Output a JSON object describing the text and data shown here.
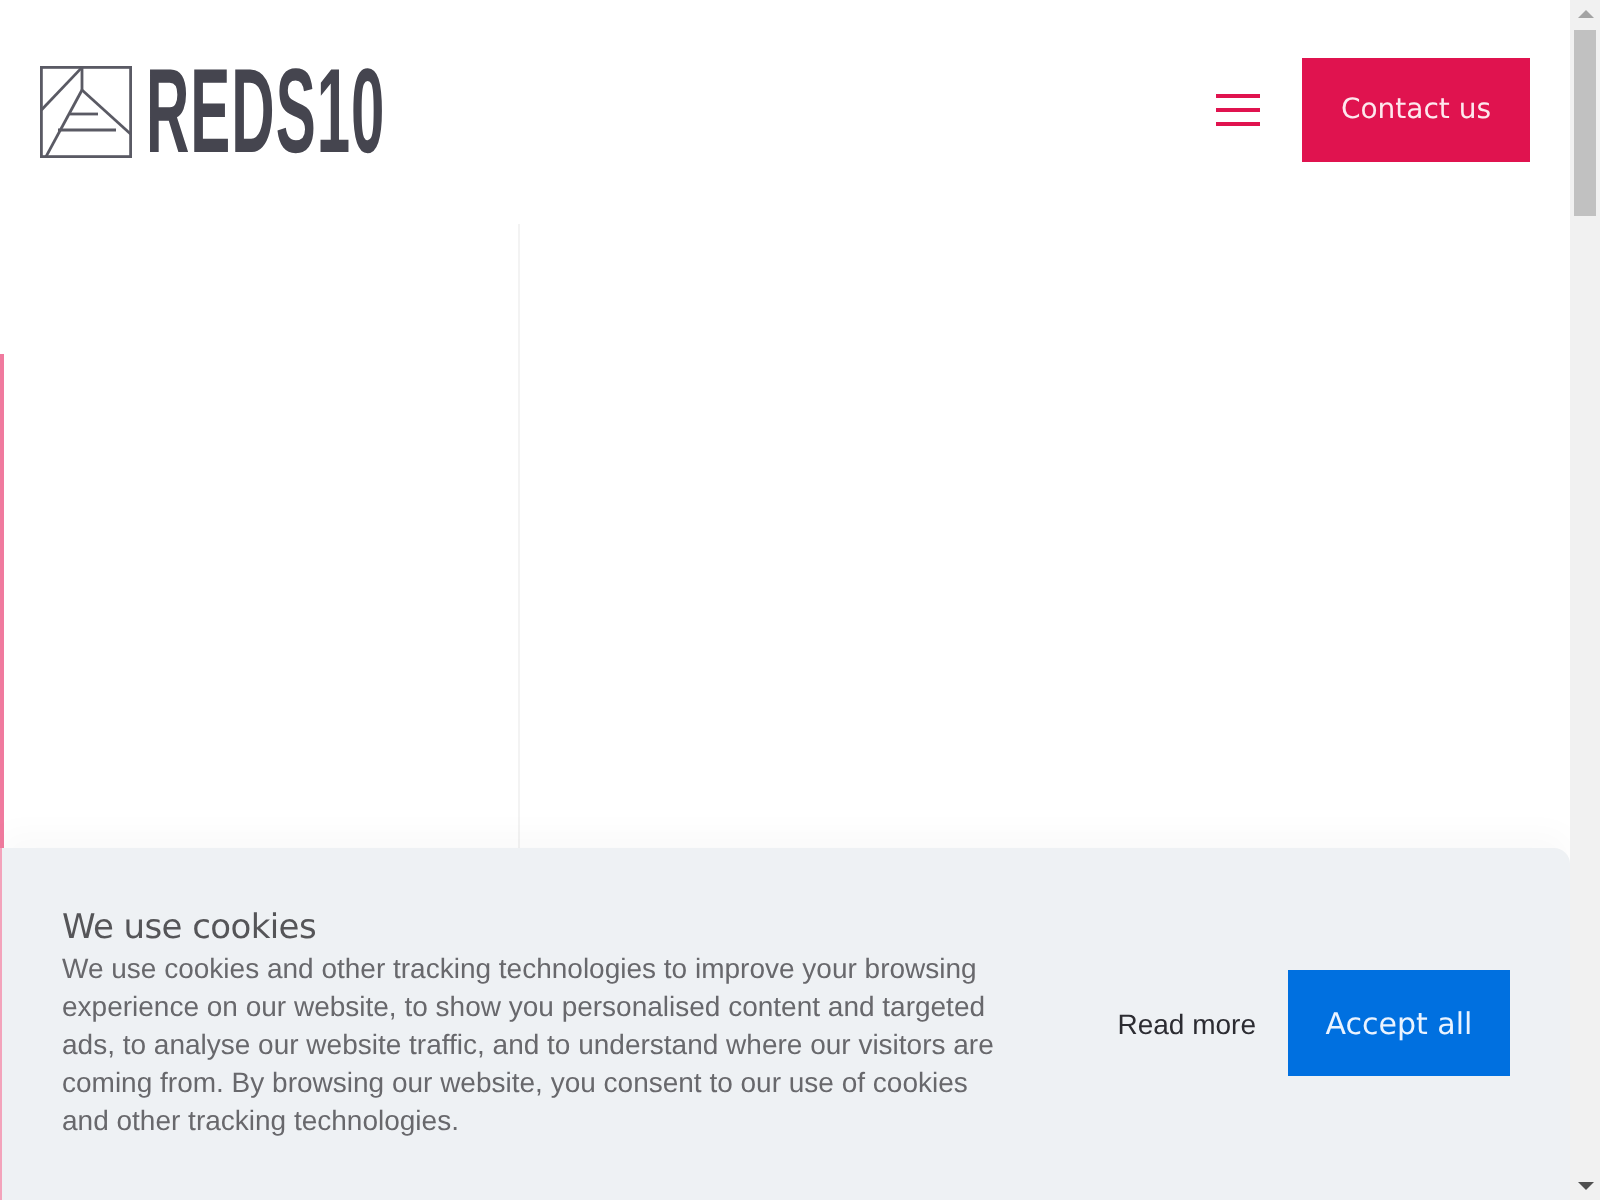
{
  "header": {
    "logo": {
      "text": "REDS10"
    },
    "contact_button": {
      "label": "Contact us"
    }
  },
  "cookie_banner": {
    "title": "We use cookies",
    "body": "We use cookies and other tracking technologies to improve your browsing experience on our website, to show you personalised content and targeted ads, to analyse our website traffic, and to understand where our visitors are coming from. By browsing our website, you consent to our use of cookies and other tracking technologies.",
    "read_more": "Read more",
    "accept_button": "Accept all"
  }
}
